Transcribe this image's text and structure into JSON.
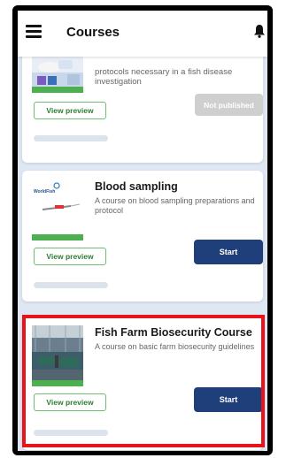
{
  "header": {
    "title": "Courses",
    "menu_icon": "menu-icon",
    "bell_icon": "bell-icon"
  },
  "courses": [
    {
      "title": "",
      "description": "protocols necessary in a fish disease investigation",
      "preview_label": "View preview",
      "action_label": "Not published",
      "action_state": "disabled"
    },
    {
      "title": "Blood sampling",
      "description": "A course on blood sampling preparations and protocol",
      "preview_label": "View preview",
      "action_label": "Start",
      "action_state": "enabled",
      "thumb_logo_text": "WorldFish"
    },
    {
      "title": "Fish Farm Biosecurity Course",
      "description": "A course on basic farm biosecurity guidelines",
      "preview_label": "View preview",
      "action_label": "Start",
      "action_state": "enabled",
      "highlighted": true
    }
  ],
  "colors": {
    "start_button": "#1f3f7a",
    "preview_border": "#6fbf73",
    "thumb_bar": "#4caf50",
    "highlight": "#e8141a",
    "disabled_button": "#cfcfcf"
  }
}
